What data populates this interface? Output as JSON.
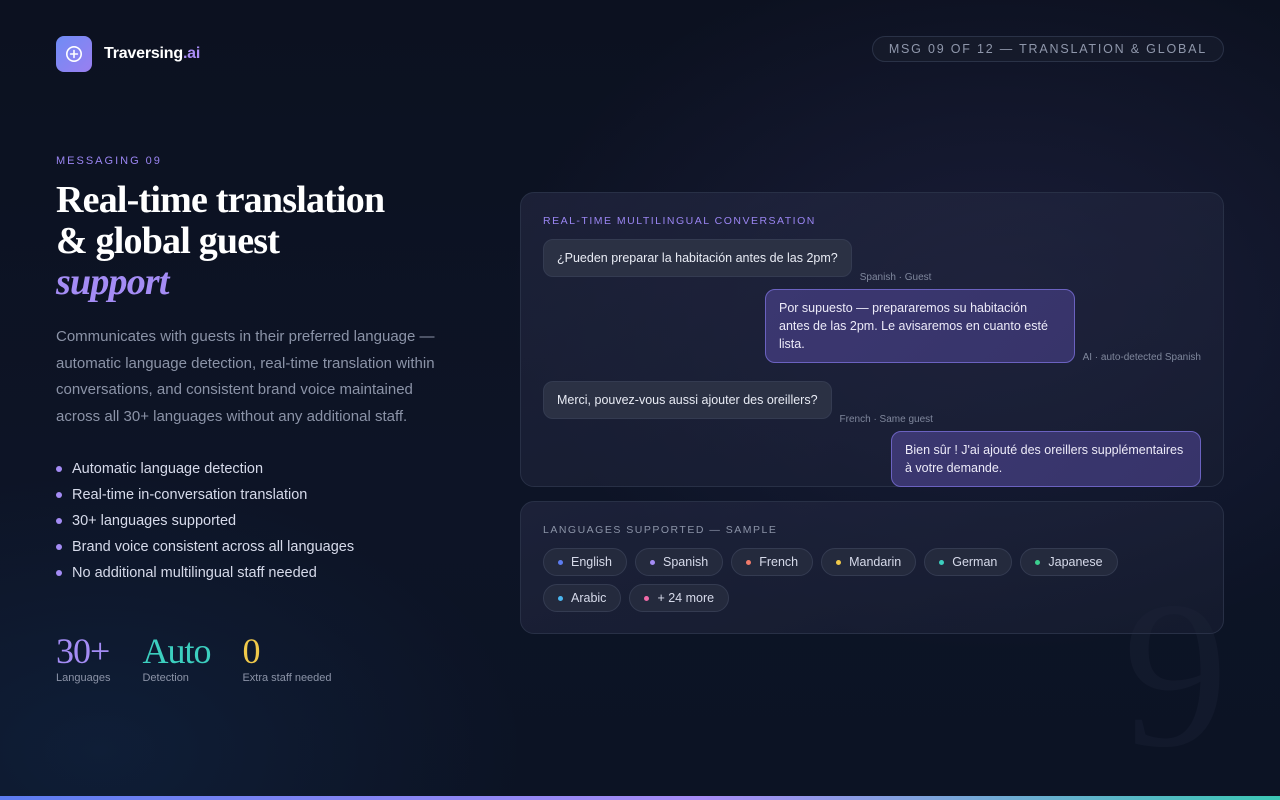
{
  "brand": {
    "name": "Traversing",
    "tld": ".ai",
    "logo_icon": "plus-circle-icon"
  },
  "progress_pill": "MSG 09 OF 12 — TRANSLATION & GLOBAL",
  "hero": {
    "eyebrow": "MESSAGING 09",
    "title_line1": "Real-time translation",
    "title_line2": "& global guest",
    "title_accent": "support",
    "description": "Communicates with guests in their preferred language — automatic language detection, real-time translation within conversations, and consistent brand voice maintained across all 30+ languages without any additional staff."
  },
  "features": [
    "Automatic language detection",
    "Real-time in-conversation translation",
    "30+ languages supported",
    "Brand voice consistent across all languages",
    "No additional multilingual staff needed"
  ],
  "stats": [
    {
      "value": "30+",
      "label": "Languages",
      "color": "#a48cf5"
    },
    {
      "value": "Auto",
      "label": "Detection",
      "color": "#3ccfbf"
    },
    {
      "value": "0",
      "label": "Extra staff needed",
      "color": "#f0c94a"
    }
  ],
  "big_number": "9",
  "conversation": {
    "title": "REAL-TIME MULTILINGUAL CONVERSATION",
    "messages": [
      {
        "role": "guest",
        "text": "¿Pueden preparar la habitación antes de las 2pm?",
        "meta": "Spanish · Guest"
      },
      {
        "role": "ai",
        "text": "Por supuesto — prepararemos su habitación antes de las 2pm. Le avisaremos en cuanto esté lista.",
        "meta": "AI · auto-detected Spanish"
      },
      {
        "role": "guest",
        "text": "Merci, pouvez-vous aussi ajouter des oreillers?",
        "meta": "French · Same guest"
      },
      {
        "role": "ai",
        "text": "Bien sûr ! J'ai ajouté des oreillers supplémentaires à votre demande.",
        "meta": ""
      }
    ]
  },
  "languages": {
    "title": "LANGUAGES SUPPORTED — SAMPLE",
    "items": [
      {
        "label": "English",
        "color": "#5c7cf0"
      },
      {
        "label": "Spanish",
        "color": "#a48cf5"
      },
      {
        "label": "French",
        "color": "#f07a6a"
      },
      {
        "label": "Mandarin",
        "color": "#f0c94a"
      },
      {
        "label": "German",
        "color": "#3ccfbf"
      },
      {
        "label": "Japanese",
        "color": "#3ccf8f"
      },
      {
        "label": "Arabic",
        "color": "#4ab6f0"
      },
      {
        "label": "+ 24 more",
        "color": "#f06aa8"
      }
    ]
  }
}
